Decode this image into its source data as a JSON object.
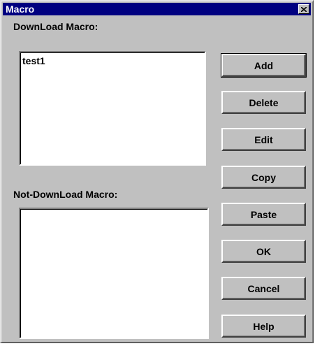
{
  "window": {
    "title": "Macro",
    "close_icon": "close-icon"
  },
  "download_section": {
    "label": "DownLoad Macro:",
    "items": [
      "test1"
    ]
  },
  "not_download_section": {
    "label": "Not-DownLoad Macro:",
    "items": []
  },
  "buttons": {
    "add": "Add",
    "delete": "Delete",
    "edit": "Edit",
    "copy": "Copy",
    "paste": "Paste",
    "ok": "OK",
    "cancel": "Cancel",
    "help": "Help"
  },
  "colors": {
    "titlebar": "#000080",
    "dialog_face": "#c0c0c0",
    "list_background": "#ffffff"
  }
}
